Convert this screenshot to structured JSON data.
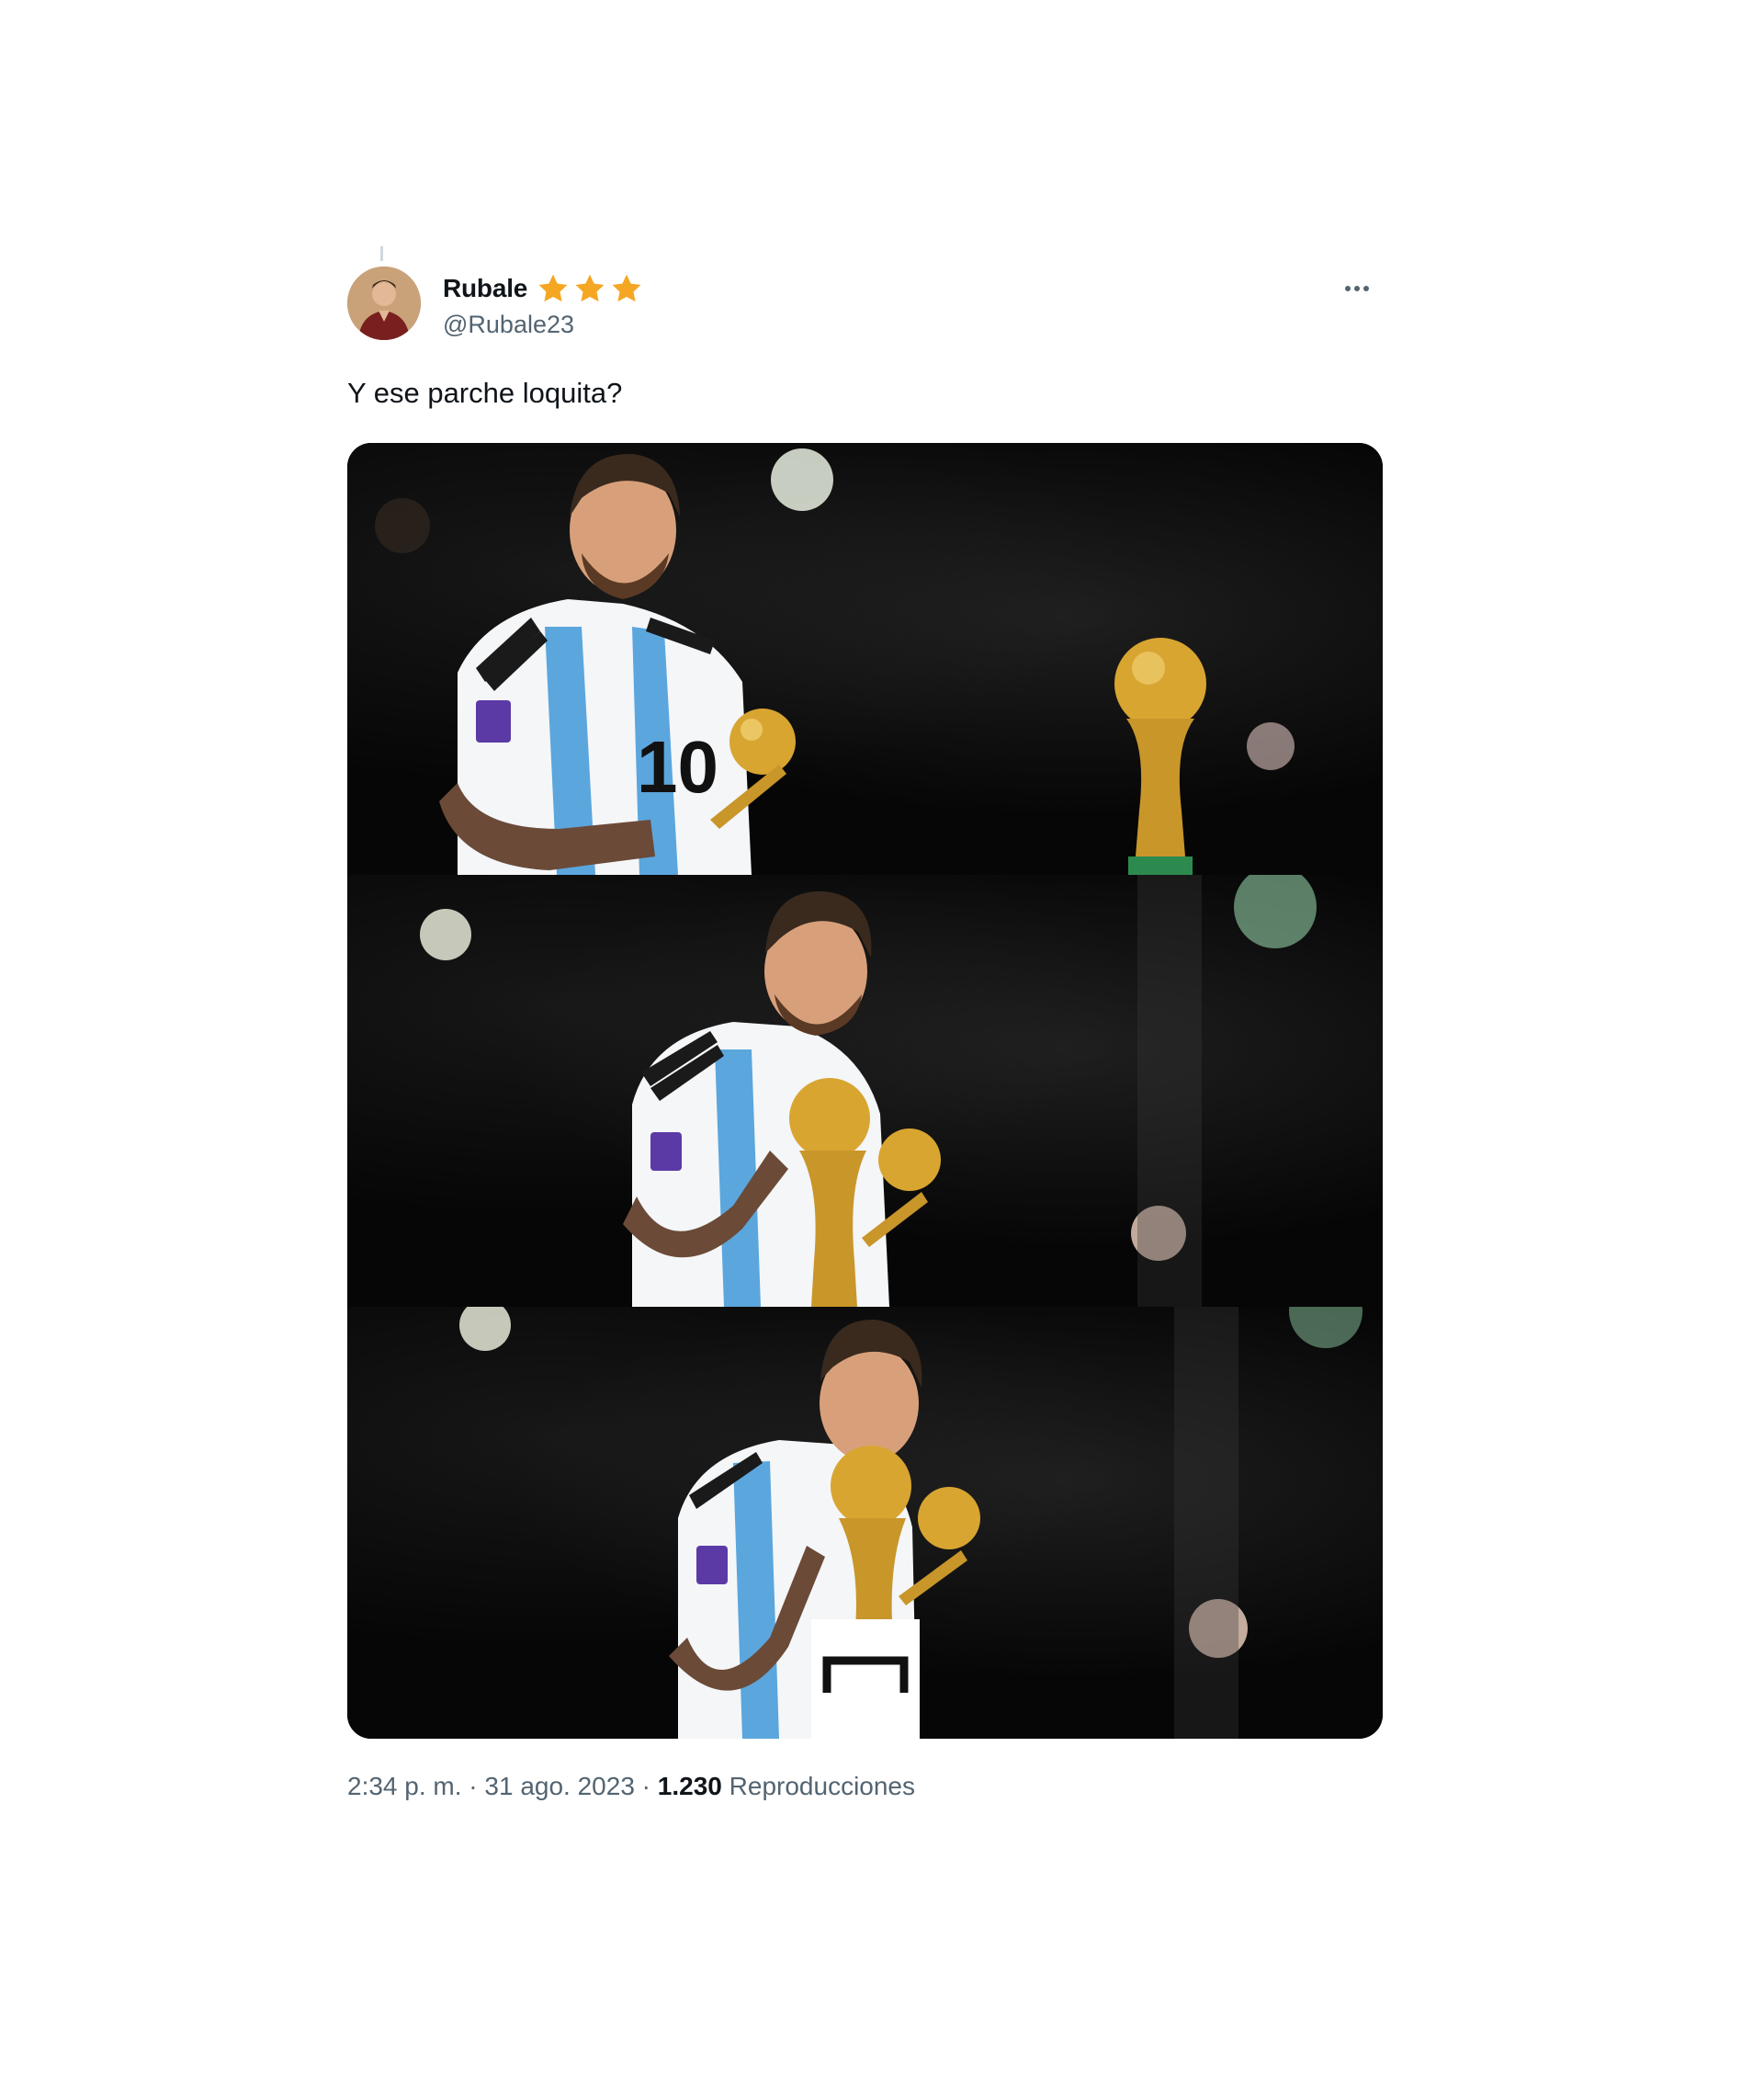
{
  "tweet": {
    "author": {
      "display_name": "Rubale",
      "handle": "@Rubale23",
      "badge_icon": "star-icon",
      "badge_count": 3,
      "badge_color": "#f5a623"
    },
    "more_icon": "more-dots-icon",
    "text": "Y ese parche loquita?",
    "media": {
      "panels": [
        {
          "name": "media-panel-1",
          "jersey_number": "10"
        },
        {
          "name": "media-panel-2"
        },
        {
          "name": "media-panel-3"
        }
      ]
    },
    "meta": {
      "time": "2:34 p. m.",
      "separator": " · ",
      "date": "31 ago. 2023",
      "views_count": "1.230",
      "views_label": "Reproducciones"
    }
  },
  "colors": {
    "text_primary": "#0f1419",
    "text_secondary": "#536471",
    "background": "#ffffff",
    "media_background": "#050505"
  }
}
